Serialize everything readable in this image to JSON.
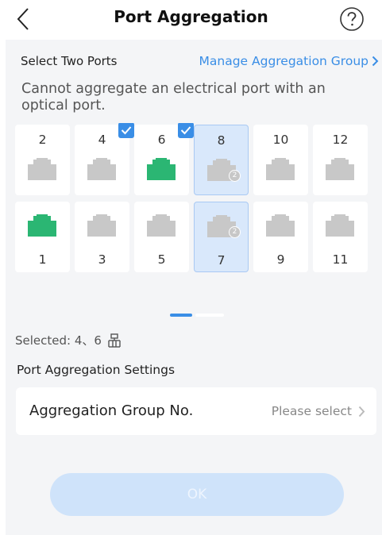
{
  "header": {
    "title": "Port Aggregation",
    "back_icon": "chevron-left-icon",
    "help_icon": "question-circle-icon"
  },
  "ports_section": {
    "label": "Select Two Ports",
    "manage_link": "Manage Aggregation Group",
    "warning": "Cannot aggregate an electrical port with an optical port."
  },
  "ports": {
    "top": [
      {
        "number": "2",
        "state": "idle"
      },
      {
        "number": "4",
        "state": "checked"
      },
      {
        "number": "6",
        "state": "checked-active"
      },
      {
        "number": "8",
        "state": "aggregated",
        "badge": "2"
      },
      {
        "number": "10",
        "state": "idle"
      },
      {
        "number": "12",
        "state": "idle"
      }
    ],
    "bottom": [
      {
        "number": "1",
        "state": "active"
      },
      {
        "number": "3",
        "state": "idle"
      },
      {
        "number": "5",
        "state": "idle"
      },
      {
        "number": "7",
        "state": "aggregated",
        "badge": "2"
      },
      {
        "number": "9",
        "state": "idle"
      },
      {
        "number": "11",
        "state": "idle"
      }
    ]
  },
  "pagination": {
    "pages": 2,
    "current": 1
  },
  "selected": {
    "text": "Selected: 4、6",
    "icon": "aggregation-icon"
  },
  "settings": {
    "label": "Port Aggregation Settings",
    "group_label": "Aggregation Group No.",
    "group_value": "Please select"
  },
  "ok_button": {
    "label": "OK",
    "enabled": false
  },
  "colors": {
    "accent": "#3a8ee6",
    "port_idle": "#c8c8c8",
    "port_active": "#2bb673",
    "port_selected_bg": "#d9e8fb"
  }
}
